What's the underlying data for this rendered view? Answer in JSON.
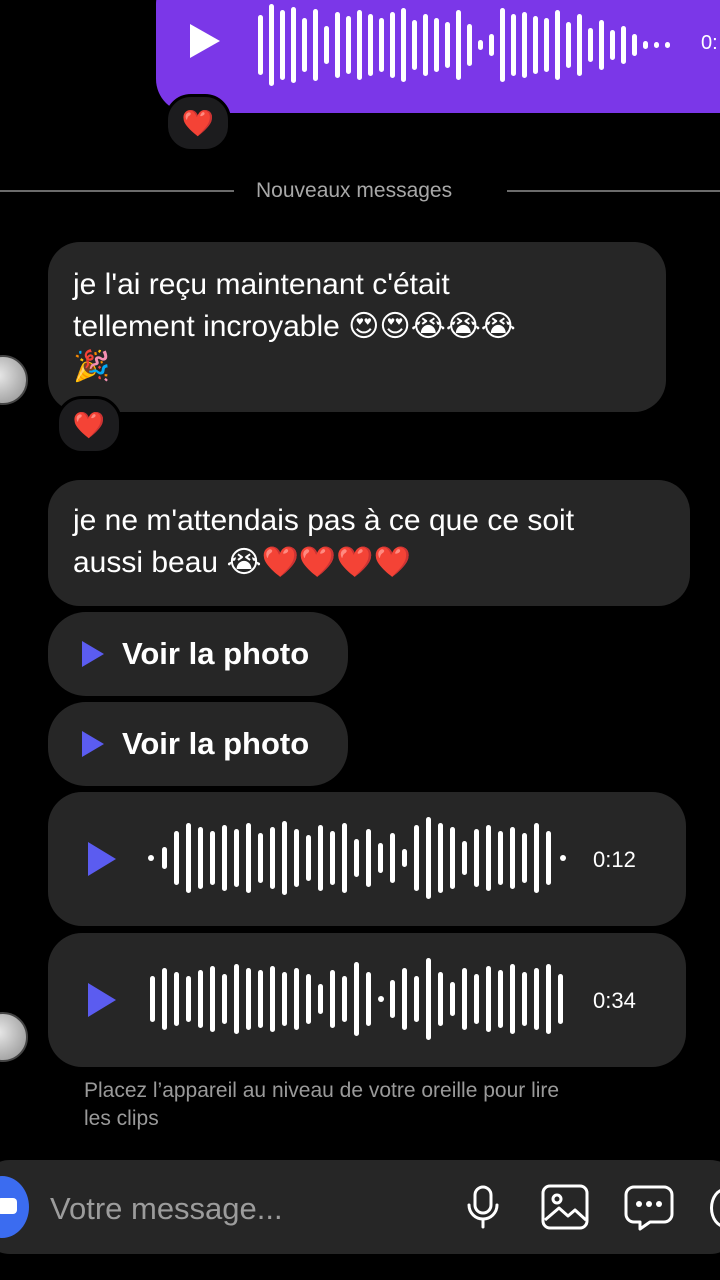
{
  "sent_voice": {
    "duration": "0:"
  },
  "reactions": {
    "heart": "❤️"
  },
  "divider": {
    "label": "Nouveaux messages"
  },
  "messages": [
    {
      "line1": "je l'ai reçu maintenant  c'était",
      "line2": "tellement incroyable 😍😍😭😭😭",
      "line3": "🎉"
    },
    {
      "line1": "je ne m'attendais pas à ce que ce soit",
      "line2": "aussi beau 😭❤️❤️❤️❤️"
    }
  ],
  "photo_buttons": [
    {
      "label": "Voir la photo"
    },
    {
      "label": "Voir la photo"
    }
  ],
  "voice_messages": [
    {
      "duration": "0:12"
    },
    {
      "duration": "0:34"
    }
  ],
  "hint": {
    "line1": "Placez l’appareil au niveau de votre oreille pour lire",
    "line2": "les clips"
  },
  "composer": {
    "placeholder": "Votre message..."
  },
  "colors": {
    "accent_purple": "#7b37e8",
    "play_blue": "#5b5cf0",
    "bubble_gray": "#262626"
  }
}
